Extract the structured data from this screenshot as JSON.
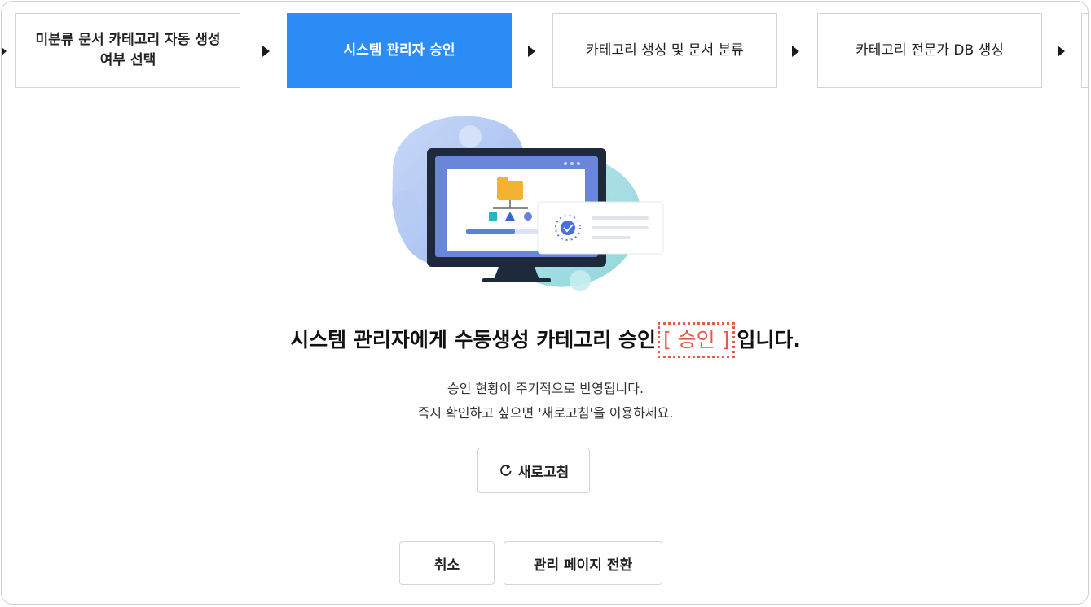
{
  "steps": [
    {
      "label_line1": "미분류 문서 카테고리 자동 생성",
      "label_line2": "여부 선택"
    },
    {
      "label": "시스템 관리자 승인"
    },
    {
      "label": "카테고리 생성 및 문서 분류"
    },
    {
      "label": "카테고리 전문가 DB 생성"
    }
  ],
  "active_step_color": "#2b8cf5",
  "message": {
    "prefix": "시스템 관리자에게 수동생성 카테고리 승인",
    "status": "[ 승인 ]",
    "suffix": "입니다.",
    "status_color": "#e55a4b",
    "line1": "승인 현황이 주기적으로 반영됩니다.",
    "line2": "즉시 확인하고 싶으면 '새로고침'을 이용하세요."
  },
  "buttons": {
    "refresh": "새로고침",
    "refresh_icon": "refresh-icon",
    "cancel": "취소",
    "switch_admin": "관리 페이지 전환"
  }
}
